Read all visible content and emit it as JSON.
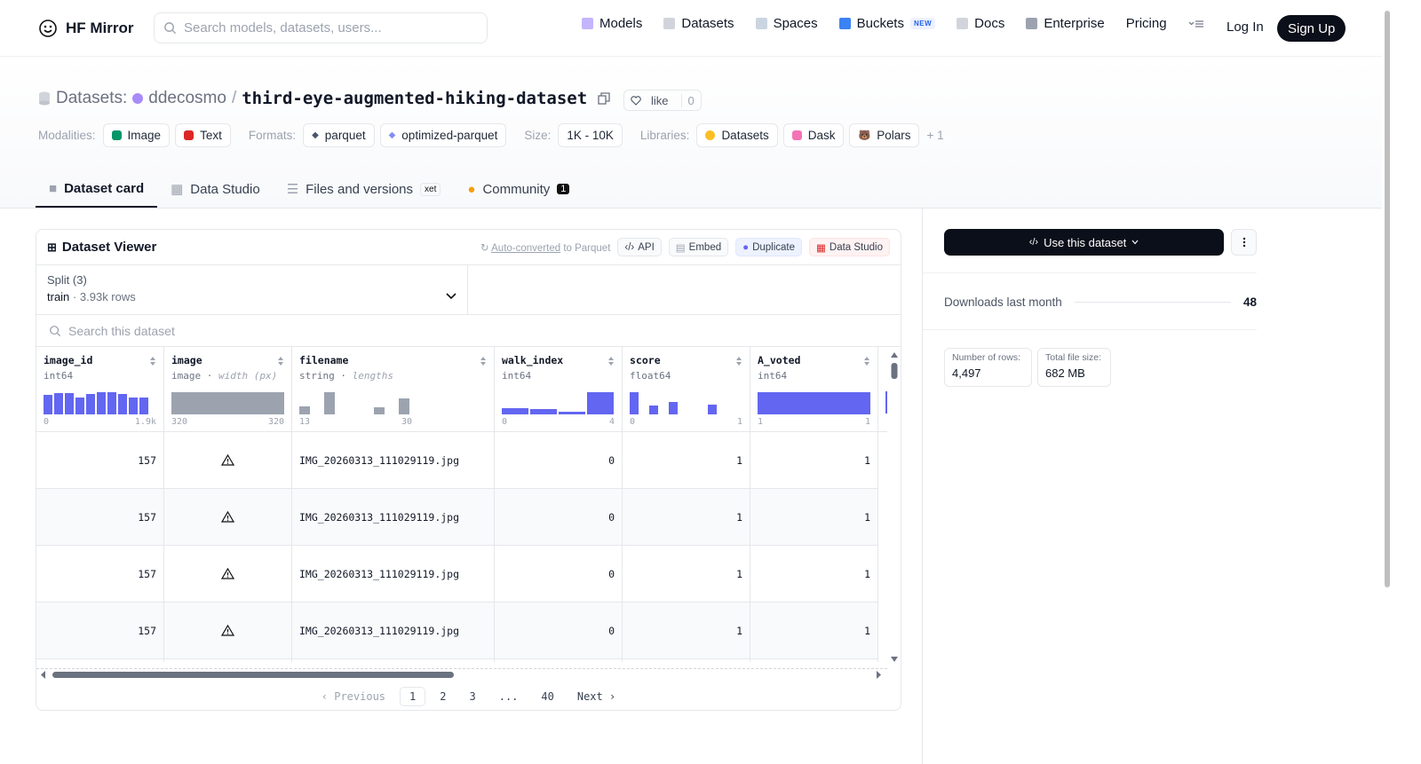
{
  "nav": {
    "logo": "HF Mirror",
    "search_placeholder": "Search models, datasets, users...",
    "links": [
      "Models",
      "Datasets",
      "Spaces",
      "Buckets",
      "Docs",
      "Enterprise",
      "Pricing"
    ],
    "buckets_badge": "NEW",
    "login": "Log In",
    "signup": "Sign Up"
  },
  "header": {
    "prefix": "Datasets:",
    "owner": "ddecosmo",
    "sep": "/",
    "name": "third-eye-augmented-hiking-dataset",
    "like_label": "like",
    "like_count": "0",
    "modalities_label": "Modalities:",
    "modalities": [
      "Image",
      "Text"
    ],
    "formats_label": "Formats:",
    "formats": [
      "parquet",
      "optimized-parquet"
    ],
    "size_label": "Size:",
    "size": "1K - 10K",
    "libraries_label": "Libraries:",
    "libraries": [
      "Datasets",
      "Dask",
      "Polars"
    ],
    "libraries_more": "+ 1"
  },
  "tabs": {
    "card": "Dataset card",
    "studio": "Data Studio",
    "files": "Files and versions",
    "xet": "xet",
    "community": "Community",
    "community_count": "1"
  },
  "viewer": {
    "title": "Dataset Viewer",
    "auto_u": "Auto-converted",
    "auto_rest": " to Parquet",
    "api": "API",
    "embed": "Embed",
    "duplicate": "Duplicate",
    "data_studio": "Data Studio",
    "split_label": "Split (3)",
    "split_value": "train",
    "split_rows": "3.93k rows",
    "search_placeholder": "Search this dataset",
    "columns": [
      {
        "name": "image_id",
        "type": "int64",
        "type_extra": "",
        "min": "0",
        "max": "1.9k"
      },
      {
        "name": "image",
        "type": "image",
        "type_extra": "width (px)",
        "min": "320",
        "max": "320"
      },
      {
        "name": "filename",
        "type": "string",
        "type_extra": "lengths",
        "min": "13",
        "max": "30"
      },
      {
        "name": "walk_index",
        "type": "int64",
        "type_extra": "",
        "min": "0",
        "max": "4"
      },
      {
        "name": "score",
        "type": "float64",
        "type_extra": "",
        "min": "0",
        "max": "1"
      },
      {
        "name": "A_voted",
        "type": "int64",
        "type_extra": "",
        "min": "1",
        "max": "1"
      }
    ],
    "rows": [
      {
        "image_id": "157",
        "filename": "IMG_20260313_111029119.jpg",
        "walk_index": "0",
        "score": "1",
        "A_voted": "1"
      },
      {
        "image_id": "157",
        "filename": "IMG_20260313_111029119.jpg",
        "walk_index": "0",
        "score": "1",
        "A_voted": "1"
      },
      {
        "image_id": "157",
        "filename": "IMG_20260313_111029119.jpg",
        "walk_index": "0",
        "score": "1",
        "A_voted": "1"
      },
      {
        "image_id": "157",
        "filename": "IMG_20260313_111029119.jpg",
        "walk_index": "0",
        "score": "1",
        "A_voted": "1"
      }
    ],
    "pager": {
      "prev": "Previous",
      "pages": [
        "1",
        "2",
        "3",
        "...",
        "40"
      ],
      "next": "Next"
    }
  },
  "sidebar": {
    "use_label": "Use this dataset",
    "downloads_label": "Downloads last month",
    "downloads_value": "48",
    "rows_label": "Number of rows:",
    "rows_value": "4,497",
    "size_label": "Total file size:",
    "size_value": "682 MB"
  },
  "colors": {
    "accent": "#6366f1",
    "dark": "#0b0f19",
    "histogram_gray": "#9ca3af"
  }
}
